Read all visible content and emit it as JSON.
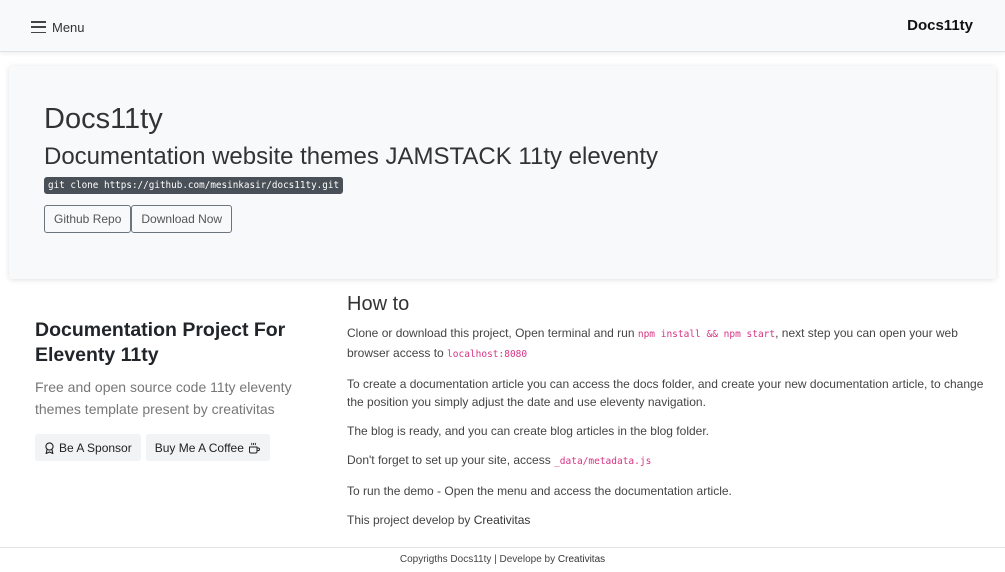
{
  "navbar": {
    "menu_label": "Menu",
    "brand": "Docs11ty"
  },
  "hero": {
    "title": "Docs11ty",
    "subtitle": "Documentation website themes JAMSTACK 11ty eleventy",
    "clone_command": "git clone https://github.com/mesinkasir/docs11ty.git",
    "buttons": {
      "github": "Github Repo",
      "download": "Download Now"
    }
  },
  "intro": {
    "title": "Documentation Project For Eleventy 11ty",
    "lead": "Free and open source code 11ty eleventy themes template present by creativitas",
    "sponsor_label": "Be A Sponsor",
    "coffee_label": "Buy Me A Coffee"
  },
  "howto": {
    "title": "How to",
    "p1": {
      "before": "Clone or download this project, Open terminal and run",
      "code1": "npm install && npm start",
      "middle": ", next step you can open your web browser access to",
      "code2": "localhost:8080"
    },
    "p2": "To create a documentation article you can access the docs folder, and create your new documentation article, to change the position you simply adjust the date and use eleventy navigation.",
    "p3": "The blog is ready, and you can create blog articles in the blog folder.",
    "p4": {
      "before": "Don't forget to set up your site, access",
      "code": "_data/metadata.js"
    },
    "p5": "To run the demo - Open the menu and access the documentation article.",
    "p6": {
      "before": "This project develop by",
      "link": "Creativitas"
    }
  },
  "footer": {
    "copyright": "Copyrigths Docs11ty | Develope by",
    "link": "Creativitas"
  },
  "icons": {
    "menu": "hamburger-icon",
    "sponsor": "award-icon",
    "coffee": "cup-hot-icon"
  }
}
